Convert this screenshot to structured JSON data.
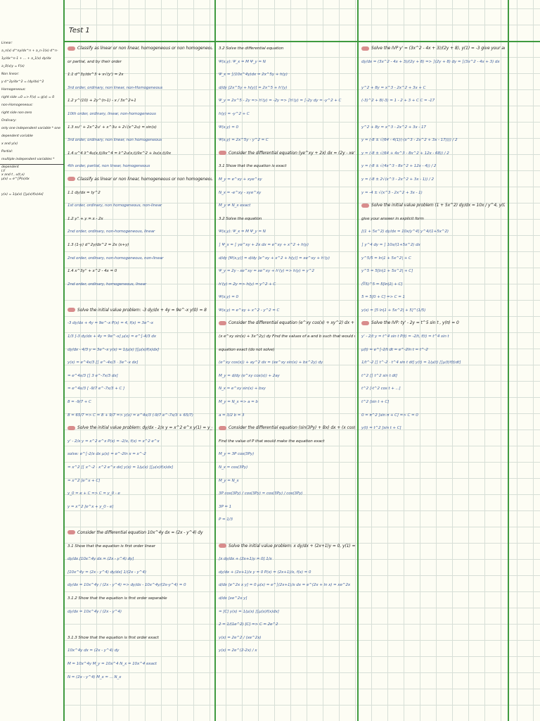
{
  "title": "Test 1",
  "sidebar": {
    "top": [
      "Linear:",
      "a_n(x) d^ny/dx^n + a_n-1(x) d^n-1y/dx^n-1 + ... + a_1(x) dy/dx",
      "a_0(x)y = F(x)",
      "Non linear:",
      "y d^2y/dx^2 = (dy/dx)^2",
      "Homogeneous:",
      "right side =0 => F(x) = g(x) = 0",
      "non-Homogeneous:",
      "right side non-zero",
      "Ordinary:",
      "only one independent variable * one",
      "dependent variable",
      "x and y(x)",
      "Partial:",
      "multiple independent variables * dependent",
      "x and t , u(t,x)"
    ],
    "bottom": [
      "I.F",
      "μ(x) = e^∫P(x)dx",
      "",
      "y(x) = 1/μ(x) [∫μ(x)f(x)dx]"
    ]
  },
  "columns": [
    {
      "lines": [
        {
          "k": "h",
          "t": "Classify as linear or non linear, homogeneous or non homogeneous, ordinary"
        },
        {
          "k": "q",
          "t": "or partial, and by their order"
        },
        {
          "k": "q",
          "t": "1.1   d^3y/dx^3 + x√(y') = 2x"
        },
        {
          "k": "a",
          "t": "3rd order, ordinary, non linear, non-Homogeneous"
        },
        {
          "k": "q",
          "t": "1.2   y^(10) + 2y^(n-1) - x / 3x^2+1"
        },
        {
          "k": "a",
          "t": "10th order, ordinary, linear, non-homogeneous"
        },
        {
          "k": "q",
          "t": "1.3   xu'' + 2x^2u' + x^3u + 2√(x^2u) = sin(x)"
        },
        {
          "k": "a",
          "t": "3rd order, ordinary, non linear, non homogeneous"
        },
        {
          "k": "q",
          "t": "1.4   u^4 ∂^4u(x,t)/∂x^4 = ∂^2u(x,t)/∂x^2 + ∂u(x,t)/∂x"
        },
        {
          "k": "a",
          "t": "4th order, partial, non linear, homogeneous"
        },
        {
          "k": "h",
          "t": "Classify as linear or non linear, homogeneous or non homogeneous, ordinary"
        },
        {
          "k": "q",
          "t": "1.1   dy/dx = ty^2"
        },
        {
          "k": "a",
          "t": "1st order, ordinary, non homogeneous, non-linear"
        },
        {
          "k": "q",
          "t": "1.2   y'' + y = x - 2x"
        },
        {
          "k": "a",
          "t": "2nd order, ordinary, non-homogeneous, linear"
        },
        {
          "k": "q",
          "t": "1.3   (1-y) d^2y/dx^2 = 2x (x+y)"
        },
        {
          "k": "a",
          "t": "2nd order, ordinary, non-homogeneous, non-linear"
        },
        {
          "k": "q",
          "t": "1.4   x^3y'' + x^2 - 4x = 0"
        },
        {
          "k": "a",
          "t": "2nd order, ordinary, homogeneous, linear"
        },
        {
          "k": "t",
          "t": ""
        },
        {
          "k": "h",
          "t": "Solve the initial value problem: -3 dy/dx + 4y = 9e^-x   y(0) = 8"
        },
        {
          "k": "a",
          "t": "-3 dy/dx + 4y = 9e^-x   P(x) = 4,  f(x) = 3e^-x"
        },
        {
          "k": "a",
          "t": "1/3 [-3 dy/dx + 4y = 9e^-x]    μ(x) = e^∫-4/3 dx"
        },
        {
          "k": "a",
          "t": "dy/dx - 4/3 y = 3e^-x        y(x) = 1/μ(x) [∫μ(x)f(x)dx]"
        },
        {
          "k": "a",
          "t": "y(x) = e^4x/3 [∫ e^-4x/3 · 3e^-x dx]"
        },
        {
          "k": "a",
          "t": "= e^4x/3 [∫ 3 e^-7x/3 dx]"
        },
        {
          "k": "a",
          "t": "= e^4x/3 [ -9/7 e^-7x/3 + C ]"
        },
        {
          "k": "a",
          "t": "8 = -9/7 + C"
        },
        {
          "k": "a",
          "t": "8 = 65/7 => C = 8 + 9/7 => y(x) = e^4x/3 (-9/7 e^-7x/3 + 65/7)"
        },
        {
          "k": "h",
          "t": "Solve the initial value problem: dy/dx - 2/x y = x^2 e^x   y(1) = y_0"
        },
        {
          "k": "a",
          "t": "y' - 2/x y = x^2 e^x     P(x) = -2/x,  f(x) = x^2 e^x"
        },
        {
          "k": "a",
          "t": "solve: e^∫-2/x dx    μ(x) = e^-2ln x = x^-2"
        },
        {
          "k": "a",
          "t": "= x^2 [∫ x^-2 · x^2 e^x dx]   y(x) = 1/μ(x) [∫μ(x)f(x)dx]"
        },
        {
          "k": "a",
          "t": "= x^2 [e^x + C]"
        },
        {
          "k": "a",
          "t": "y_0 = e + C  => C = y_0 - e"
        },
        {
          "k": "a",
          "t": "y = x^2 [e^x + y_0 - e]"
        },
        {
          "k": "t",
          "t": ""
        },
        {
          "k": "h",
          "t": "Consider the differential equation 10x^4y dx = (2x - y^4) dy"
        },
        {
          "k": "q",
          "t": "3.1   Show that the equation is first order linear"
        },
        {
          "k": "a",
          "t": "dy/dx [10x^4y dx = (2x - y^4) dy]"
        },
        {
          "k": "a",
          "t": "[10x^4y = (2x - y^4) dy/dx]  1/(2x - y^4)"
        },
        {
          "k": "a",
          "t": "dy/dx = 10x^4y / (2x - y^4)   =>  dy/dx - 10x^4y/(2x-y^4) = 0"
        },
        {
          "k": "q",
          "t": "3.1.2   Show that the equation is first order separable"
        },
        {
          "k": "a",
          "t": "dy/dx = 10x^4y / (2x - y^4)"
        },
        {
          "k": "t",
          "t": ""
        },
        {
          "k": "q",
          "t": "3.1.3   Show that the equation is first order exact"
        },
        {
          "k": "a",
          "t": "10x^4y dx = (2x - y^4) dy"
        },
        {
          "k": "a",
          "t": "M = 10x^4y    M_y = 10x^4    N_x = 10x^4   exact"
        },
        {
          "k": "a",
          "t": "N = (2x - y^4)    M_x = ... N_x"
        }
      ]
    },
    {
      "lines": [
        {
          "k": "q",
          "t": "3.2   Solve the differential equation"
        },
        {
          "k": "a",
          "t": "Ψ(x,y):   Ψ_x = M    Ψ_y = N"
        },
        {
          "k": "a",
          "t": "Ψ_x = ∫(10x^4y)dx = 2x^5y + h(y)"
        },
        {
          "k": "a",
          "t": "d/dy [2x^5y + h(y)] = 2x^5 + h'(y)"
        },
        {
          "k": "a",
          "t": "Ψ_y = 2x^5 - 2y => h'(y) = -2y => ∫h'(y) = ∫-2y dy = -y^2 + C"
        },
        {
          "k": "a",
          "t": "h(y) = -y^2 + C"
        },
        {
          "k": "a",
          "t": "Ψ(x,y) = 0"
        },
        {
          "k": "a",
          "t": "Ψ(x,y) = 2x^5y - y^2 = C"
        },
        {
          "k": "h",
          "t": "Consider the differential equation (ye^xy + 2x) dx = (2y - xe^xy) dy"
        },
        {
          "k": "q",
          "t": "3.1   Show that the equation is exact"
        },
        {
          "k": "a",
          "t": "M_y = e^xy + xye^xy"
        },
        {
          "k": "a",
          "t": "N_x = -e^xy - xye^xy"
        },
        {
          "k": "a",
          "t": "M_y ≠ N_x   exact"
        },
        {
          "k": "q",
          "t": "3.2   Solve the equation"
        },
        {
          "k": "a",
          "t": "Ψ(x,y):   Ψ_x = M   Ψ_y = N"
        },
        {
          "k": "a",
          "t": "∫ Ψ_x = ∫ ye^xy + 2x dx = e^xy + x^2 + h(y)"
        },
        {
          "k": "a",
          "t": "d/dy [Ψ(x,y)] = d/dy [e^xy + x^2 + h(y)] = xe^xy + h'(y)"
        },
        {
          "k": "a",
          "t": "Ψ_y = 2y - xe^xy = xe^xy + h'(y) => h(y) = y^2"
        },
        {
          "k": "a",
          "t": "h'(y) = 2y  =>  h(y) = y^2 + C"
        },
        {
          "k": "a",
          "t": "Ψ(x,y) = 0"
        },
        {
          "k": "a",
          "t": "Ψ(x,y) = e^xy + x^2 - y^2 = C"
        },
        {
          "k": "h",
          "t": "Consider the differential equation (e^xy cos(x) + xy^2) dx +"
        },
        {
          "k": "q",
          "t": "(x e^xy sin(x) + 3x^2y) dy   Find the values of a and b such that would make the"
        },
        {
          "k": "q",
          "t": "equation exact (do not solve)"
        },
        {
          "k": "a",
          "t": "(e^xy cos(x)) + ay^2 dx = (xe^xy sin(x) + bx^2y) dy"
        },
        {
          "k": "a",
          "t": "M_y = d/dy (e^xy cos(x)) + 2ay"
        },
        {
          "k": "a",
          "t": "N_x = e^xy sin(x) + bxy"
        },
        {
          "k": "a",
          "t": "M_y = N_x => a = b"
        },
        {
          "k": "a",
          "t": "a = 3/2   b = 3"
        },
        {
          "k": "h",
          "t": "Consider the differential equation (sin(3Py) + Bx) dx + (x cos(3Py)) dy"
        },
        {
          "k": "q",
          "t": "Find the value of P that would make the equation exact"
        },
        {
          "k": "a",
          "t": "M_y = 3P cos(3Py)"
        },
        {
          "k": "a",
          "t": "N_x = cos(3Py)"
        },
        {
          "k": "a",
          "t": "M_y = N_x"
        },
        {
          "k": "a",
          "t": "3P cos(3Py) / cos(3Py) = cos(3Py) / cos(3Py)"
        },
        {
          "k": "a",
          "t": "3P = 1"
        },
        {
          "k": "a",
          "t": "P = 1/3"
        },
        {
          "k": "t",
          "t": ""
        },
        {
          "k": "h",
          "t": "Solve the initial value problem: x dy/dx + (2x+1)y = 0,  y(1) = 2"
        },
        {
          "k": "a",
          "t": "[x dy/dx + (2x+1)y = 0] 1/x"
        },
        {
          "k": "a",
          "t": "dy/dx + (2x+1)/x y = 0     P(x) = (2x+1)/x,  f(x) = 0"
        },
        {
          "k": "a",
          "t": "d/dx [e^2x x y] = 0    μ(x) = e^∫(2x+1)/x dx = e^(2x + ln x) = xe^2x"
        },
        {
          "k": "a",
          "t": "d/dx [xe^2x y]"
        },
        {
          "k": "a",
          "t": "= [C]        y(x) = 1/μ(x) [∫μ(x)f(x)dx]"
        },
        {
          "k": "a",
          "t": "2 = 1/(1e^2) [C] => C = 2e^2"
        },
        {
          "k": "a",
          "t": "y(x) = 2e^2 / (xe^2x)"
        },
        {
          "k": "a",
          "t": "y(x) = 2e^(2-2x) / x"
        }
      ]
    },
    {
      "lines": [
        {
          "k": "h",
          "t": "Solve the IVP  y' = (3x^2 - 4x + 3)/(2y + 8),  y(1) = -3   give your answer in explicit form"
        },
        {
          "k": "a",
          "t": "dy/dx = (3x^2 - 4x + 3)/(2y + 8)   =>  ∫(2y + 8) dy = ∫(3x^2 - 4x + 3) dx"
        },
        {
          "k": "t",
          "t": ""
        },
        {
          "k": "a",
          "t": "y^2 + 8y = x^3 - 2x^2 + 3x + C"
        },
        {
          "k": "a",
          "t": "(-3)^2 + 8(-3) = 1 - 2 + 3 + C      C = -17"
        },
        {
          "k": "t",
          "t": ""
        },
        {
          "k": "a",
          "t": "y^2 + 8y = x^3 - 2x^2 + 3x - 17"
        },
        {
          "k": "a",
          "t": "y = (-8 ± √(64 - 4(1)(-(x^3 - 2x^2 + 3x - 17)))) / 2"
        },
        {
          "k": "a",
          "t": "y = (-8 ± √(64 + 4x^3 - 8x^2 + 12x - 68)) / 2"
        },
        {
          "k": "a",
          "t": "y = (-8 ± √(4x^3 - 8x^2 + 12x - 4)) / 2"
        },
        {
          "k": "a",
          "t": "y = (-8 ± 2√(x^3 - 2x^2 + 3x - 1)) / 2"
        },
        {
          "k": "a",
          "t": "y = -4 ± √(x^3 - 2x^2 + 3x - 1)"
        },
        {
          "k": "h",
          "t": "Solve the initial value problem  (1 + 5x^2) dy/dx = 10x / y^4,  y(0) = ∜5"
        },
        {
          "k": "q",
          "t": "give your answer in explicit form"
        },
        {
          "k": "a",
          "t": "[(1 + 5x^2) dy/dx = 10x/y^4]  y^4/(1+5x^2)"
        },
        {
          "k": "a",
          "t": "∫ y^4 dy = ∫ 10x/(1+5x^2) dx"
        },
        {
          "k": "a",
          "t": "y^5/5 = ln|1 + 5x^2| + C"
        },
        {
          "k": "a",
          "t": "y^5 = 5[ln|1 + 5x^2| + C]"
        },
        {
          "k": "a",
          "t": "(∜5)^5 = 5[ln|1| + C]"
        },
        {
          "k": "a",
          "t": "5 = 5[0 + C]   =>  C = 1"
        },
        {
          "k": "a",
          "t": "y(x) = [5 ln|1 + 5x^2| + 5]^(1/5)"
        },
        {
          "k": "h",
          "t": "Solve the IVP:  ty' - 2y = t^5 sin t ,  y(π) = 0"
        },
        {
          "k": "a",
          "t": "y' - 2/t y = t^4 sin t      P(t) = -2/t,  f(t) = t^4 sin t"
        },
        {
          "k": "a",
          "t": "μ(t) = e^∫-2/t dt = e^-2ln t = t^-2"
        },
        {
          "k": "a",
          "t": "1/t^-2 [∫ t^-2 · t^4 sin t dt]     y(t) = 1/μ(t) [∫μ(t)f(t)dt]"
        },
        {
          "k": "a",
          "t": "t^2 [∫ t^2 sin t dt]"
        },
        {
          "k": "a",
          "t": "t^2 [-t^2 cos t + ...]"
        },
        {
          "k": "a",
          "t": "t^2 [sin t + C]"
        },
        {
          "k": "a",
          "t": "0 = π^2 [sin π + C]  =>  C = 0"
        },
        {
          "k": "a",
          "t": "y(t) = t^2 [sin t + C]"
        }
      ]
    }
  ]
}
